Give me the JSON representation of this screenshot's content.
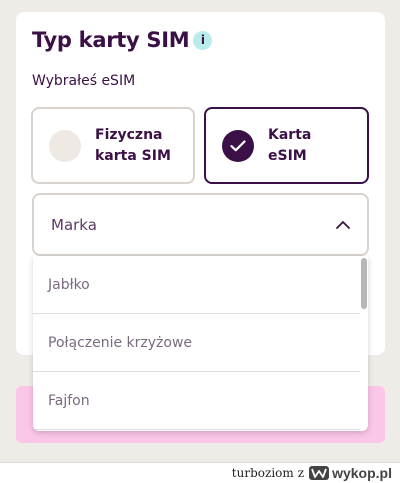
{
  "form": {
    "title": "Typ karty SIM",
    "info_icon_glyph": "i",
    "subtitle": "Wybrałeś eSIM",
    "options": [
      {
        "label_line1": "Fizyczna",
        "label_line2": "karta SIM",
        "selected": false
      },
      {
        "label_line1": "Karta",
        "label_line2": "eSIM",
        "selected": true
      }
    ],
    "brand_select": {
      "label": "Marka",
      "expanded": true,
      "options": [
        "Jabłko",
        "Połączenie krzyżowe",
        "Fajfon"
      ]
    }
  },
  "footer": {
    "user": "turboziom",
    "connector": "z",
    "site": "wykop.pl"
  },
  "colors": {
    "primary": "#3b1046",
    "accent_pink": "#fbc6e8",
    "info_badge": "#b9ecea",
    "border": "#d8d3cf",
    "page_bg": "#efece8"
  },
  "icons": {
    "info": "info-icon",
    "check": "check-icon",
    "chevron": "chevron-up-icon",
    "logo": "wykop-logo-icon"
  }
}
